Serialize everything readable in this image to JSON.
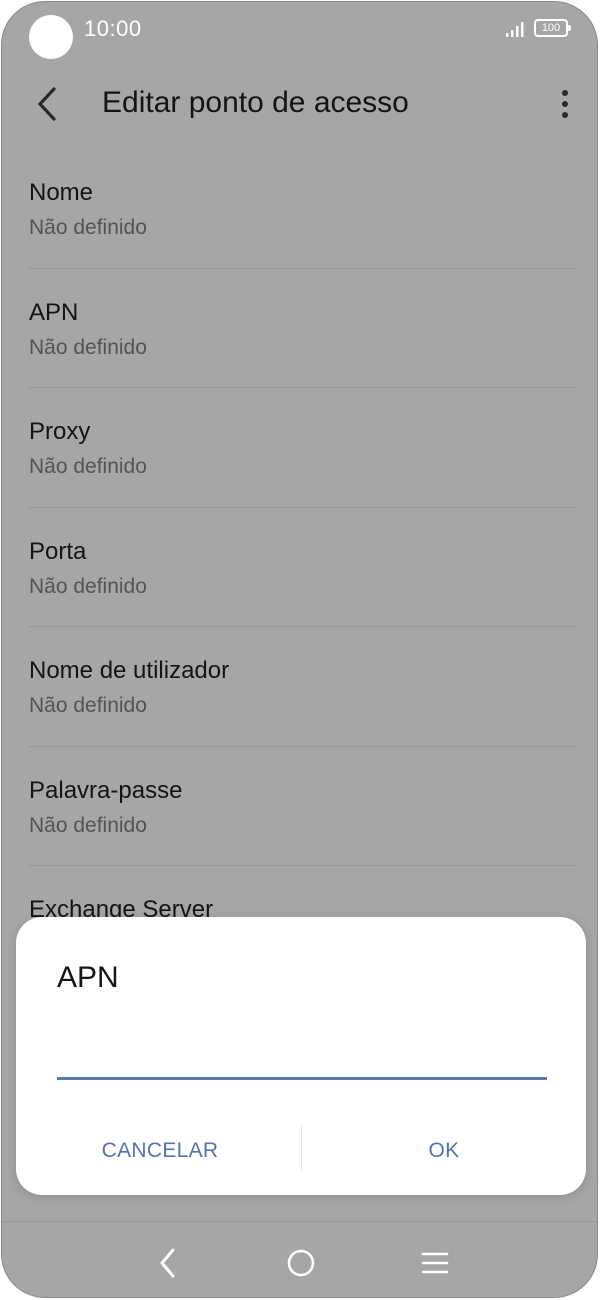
{
  "status_bar": {
    "time": "10:00",
    "battery_level": "100",
    "icons": [
      "camera-cutout",
      "signal-icon",
      "battery-icon"
    ]
  },
  "app_bar": {
    "title": "Editar ponto de acesso",
    "icons": [
      "back-arrow-icon",
      "more-vert-icon"
    ]
  },
  "settings": {
    "items": [
      {
        "title": "Nome",
        "value": "Não definido"
      },
      {
        "title": "APN",
        "value": "Não definido"
      },
      {
        "title": "Proxy",
        "value": "Não definido"
      },
      {
        "title": "Porta",
        "value": "Não definido"
      },
      {
        "title": "Nome de utilizador",
        "value": "Não definido"
      },
      {
        "title": "Palavra-passe",
        "value": "Não definido"
      },
      {
        "title": "Exchange Server"
      }
    ]
  },
  "dialog": {
    "title": "APN",
    "input_value": "",
    "cancel_label": "CANCELAR",
    "ok_label": "OK"
  },
  "nav_bar": {
    "icons": [
      "nav-back-icon",
      "nav-home-icon",
      "nav-recents-icon"
    ]
  },
  "colors": {
    "background_dimmed": "#a6a6a6",
    "dialog_background": "#ffffff",
    "accent": "#5673ab",
    "input_underline": "#5b79b5",
    "primary_text": "#141414",
    "secondary_text": "#545454"
  }
}
